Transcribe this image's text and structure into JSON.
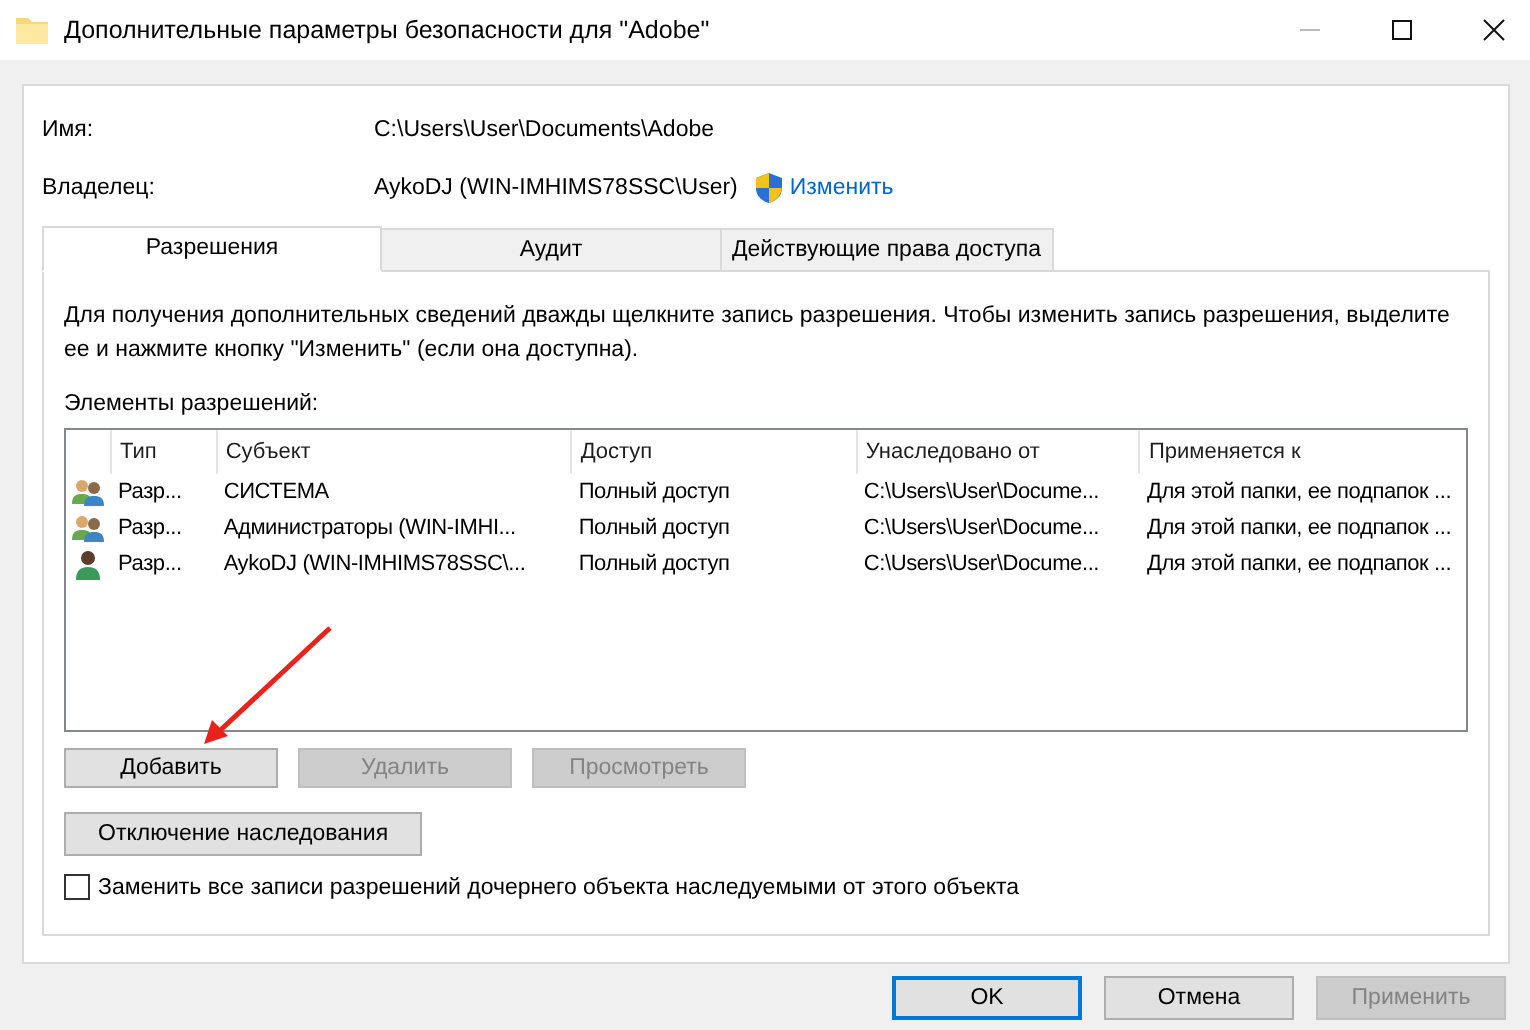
{
  "window": {
    "title": "Дополнительные параметры безопасности  для \"Adobe\""
  },
  "name_label": "Имя:",
  "name_value": "C:\\Users\\User\\Documents\\Adobe",
  "owner_label": "Владелец:",
  "owner_value": "AykoDJ (WIN-IMHIMS78SSC\\User)",
  "owner_change_link": "Изменить",
  "tabs": [
    {
      "label": "Разрешения",
      "selected": true
    },
    {
      "label": "Аудит",
      "selected": false
    },
    {
      "label": "Действующие права доступа",
      "selected": false
    }
  ],
  "info_text": "Для получения дополнительных сведений дважды щелкните запись разрешения. Чтобы изменить запись разрешения, выделите ее и нажмите кнопку \"Изменить\" (если она доступна).",
  "list_label": "Элементы разрешений:",
  "table": {
    "columns": [
      "Тип",
      "Субъект",
      "Доступ",
      "Унаследовано от",
      "Применяется к"
    ],
    "rows": [
      {
        "kind": "group",
        "cells": [
          "Разр...",
          "СИСТЕМА",
          "Полный доступ",
          "C:\\Users\\User\\Docume...",
          "Для этой папки, ее подпапок ..."
        ]
      },
      {
        "kind": "group",
        "cells": [
          "Разр...",
          "Администраторы (WIN-IMHI...",
          "Полный доступ",
          "C:\\Users\\User\\Docume...",
          "Для этой папки, ее подпапок ..."
        ]
      },
      {
        "kind": "user",
        "cells": [
          "Разр...",
          "AykoDJ (WIN-IMHIMS78SSC\\...",
          "Полный доступ",
          "C:\\Users\\User\\Docume...",
          "Для этой папки, ее подпапок ..."
        ]
      }
    ]
  },
  "action_buttons": [
    {
      "label": "Добавить",
      "disabled": false
    },
    {
      "label": "Удалить",
      "disabled": true
    },
    {
      "label": "Просмотреть",
      "disabled": true
    }
  ],
  "inheritance_button": "Отключение наследования",
  "replace_checkbox": {
    "label": "Заменить все записи разрешений дочернего объекта наследуемыми от этого объекта",
    "checked": false
  },
  "dialog_buttons": [
    {
      "label": "OK",
      "disabled": false,
      "default": true
    },
    {
      "label": "Отмена",
      "disabled": false,
      "default": false
    },
    {
      "label": "Применить",
      "disabled": true,
      "default": false
    }
  ]
}
